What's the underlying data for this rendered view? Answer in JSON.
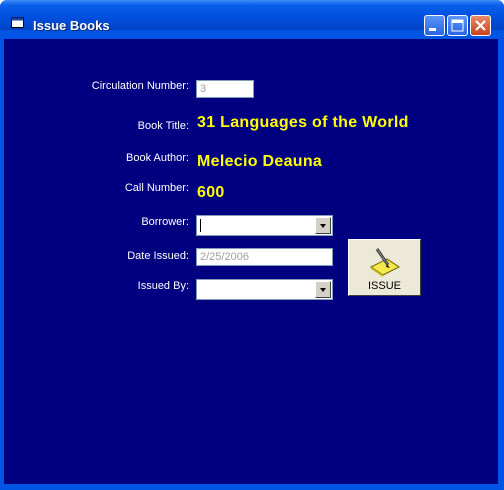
{
  "window": {
    "title": "Issue Books"
  },
  "form": {
    "circulation_label": "Circulation Number:",
    "circulation_value": "3",
    "title_label": "Book Title:",
    "title_value": "31 Languages of the  World",
    "author_label": "Book Author:",
    "author_value": "Melecio Deauna",
    "call_label": "Call Number:",
    "call_value": "600",
    "borrower_label": "Borrower:",
    "borrower_value": "",
    "date_label": "Date Issued:",
    "date_value": "2/25/2006",
    "issuedby_label": "Issued By:",
    "issuedby_value": ""
  },
  "issue_button": {
    "label": "ISSUE",
    "icon": "pencil-notepad-icon"
  },
  "colors": {
    "client_bg": "#000080",
    "value_text": "#ffff00",
    "label_text": "#ffffff"
  }
}
